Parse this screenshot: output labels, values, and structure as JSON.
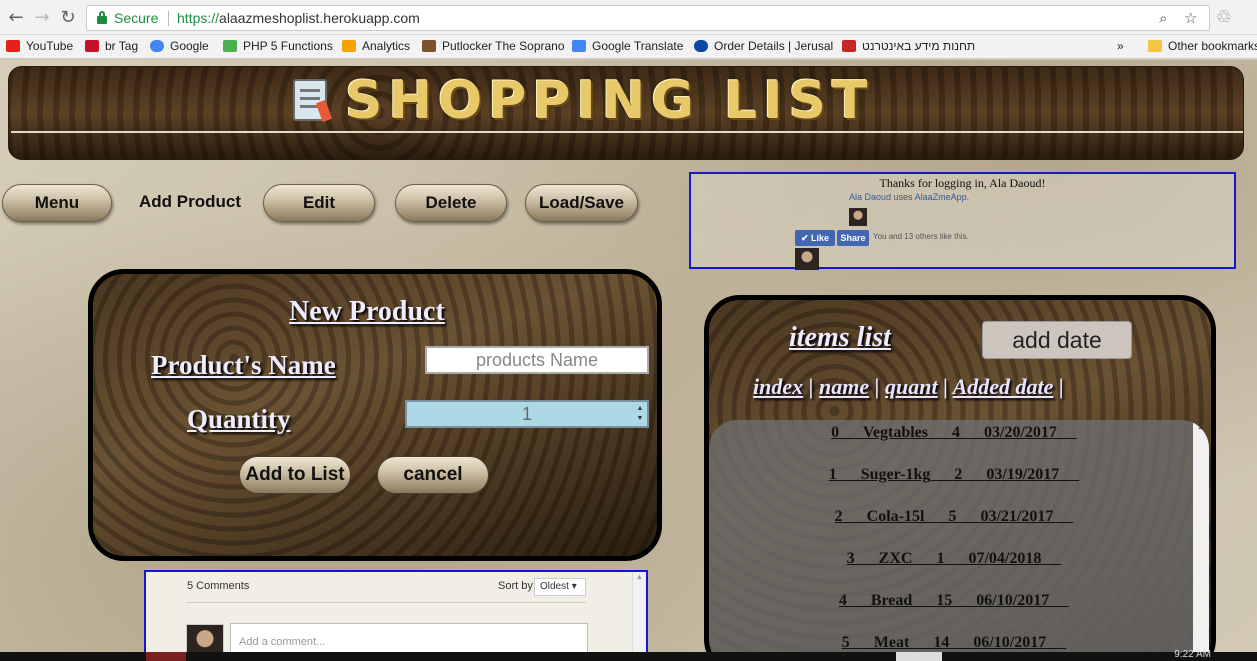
{
  "browser": {
    "secure_label": "Secure",
    "url_scheme": "https://",
    "url_host": "alaazmeshoplist.herokuapp.com",
    "icons": [
      "back-icon",
      "forward-icon",
      "reload-icon",
      "lock-icon",
      "zoom-icon",
      "star-icon",
      "extension-icon"
    ]
  },
  "bookmarks": {
    "items": [
      {
        "label": "YouTube",
        "color": "#e62117"
      },
      {
        "label": "br Tag",
        "color": "#c8102e"
      },
      {
        "label": "Google",
        "color": "#4285f4"
      },
      {
        "label": "PHP 5 Functions",
        "color": "#4caf50"
      },
      {
        "label": "Analytics",
        "color": "#f4a300"
      },
      {
        "label": "Putlocker The Soprano",
        "color": "#7a5230"
      },
      {
        "label": "Google Translate",
        "color": "#4285f4"
      },
      {
        "label": "Order Details | Jerusal",
        "color": "#0d47a1"
      },
      {
        "label": "תחנות מידע באינטרנט",
        "color": "#c62828"
      }
    ],
    "overflow": "»",
    "other": "Other bookmarks"
  },
  "app": {
    "title": "SHOPPING LIST",
    "menu": {
      "menu": "Menu",
      "add_product": "Add Product",
      "edit": "Edit",
      "delete": "Delete",
      "load_save": "Load/Save"
    }
  },
  "new_product": {
    "title": "New Product",
    "name_label": "Product's Name",
    "name_placeholder": "products Name",
    "quantity_label": "Quantity",
    "quantity_value": "1",
    "add_button": "Add to List",
    "cancel_button": "cancel"
  },
  "comments": {
    "count": "5 Comments",
    "sort_label": "Sort by",
    "sort_value": "Oldest",
    "placeholder": "Add a comment..."
  },
  "facebook": {
    "thanks": "Thanks for logging in, Ala Daoud!",
    "user": "Ala Daoud",
    "uses": "uses",
    "app": "AlaaZmeApp",
    "like": "Like",
    "share": "Share",
    "likes_text": "You and 13 others like this."
  },
  "items_list": {
    "title": "items list",
    "add_date_button": "add date",
    "headers": [
      "index",
      "name",
      "quant",
      "Added date"
    ],
    "rows": [
      {
        "index": "0",
        "name": "Vegtables",
        "quant": "4",
        "date": "03/20/2017"
      },
      {
        "index": "1",
        "name": "Suger-1kg",
        "quant": "2",
        "date": "03/19/2017"
      },
      {
        "index": "2",
        "name": "Cola-15l",
        "quant": "5",
        "date": "03/21/2017"
      },
      {
        "index": "3",
        "name": "ZXC",
        "quant": "1",
        "date": "07/04/2018"
      },
      {
        "index": "4",
        "name": "Bread",
        "quant": "15",
        "date": "06/10/2017"
      },
      {
        "index": "5",
        "name": "Meat",
        "quant": "14",
        "date": "06/10/2017"
      }
    ]
  },
  "taskbar": {
    "clock": "9:22 AM"
  }
}
